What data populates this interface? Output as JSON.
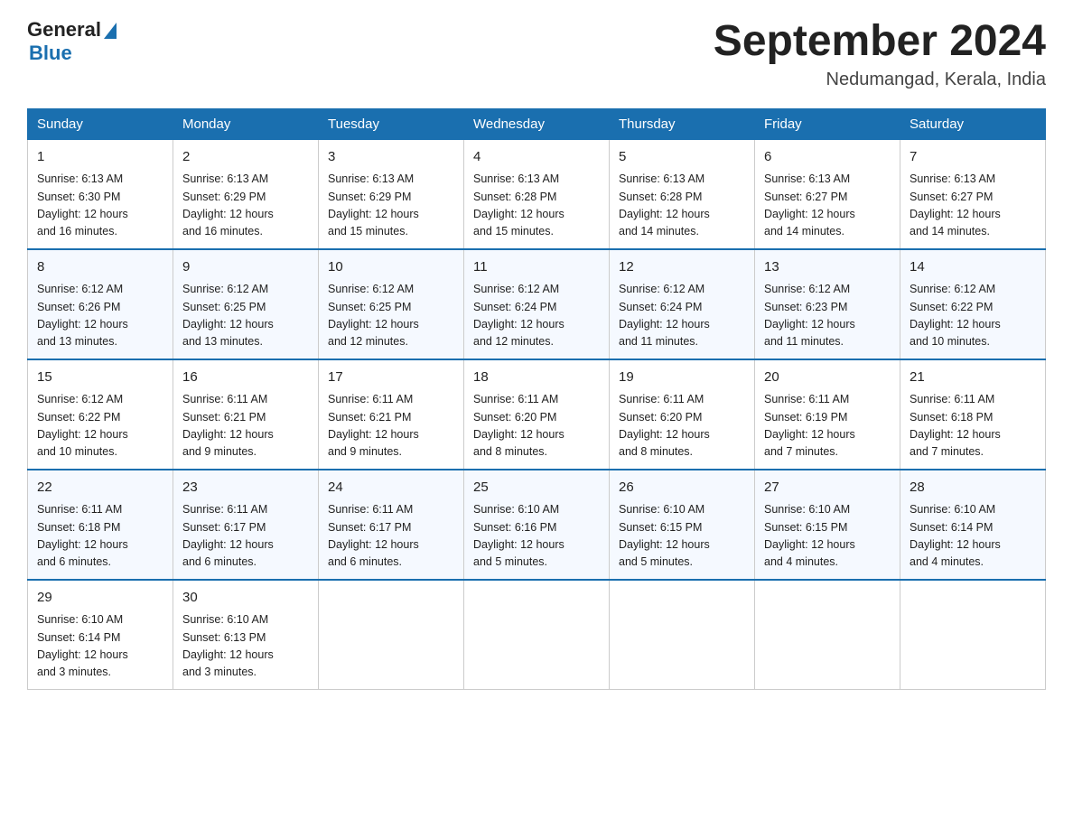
{
  "header": {
    "logo_general": "General",
    "logo_blue": "Blue",
    "title": "September 2024",
    "subtitle": "Nedumangad, Kerala, India"
  },
  "days_of_week": [
    "Sunday",
    "Monday",
    "Tuesday",
    "Wednesday",
    "Thursday",
    "Friday",
    "Saturday"
  ],
  "weeks": [
    [
      {
        "day": "1",
        "sunrise": "6:13 AM",
        "sunset": "6:30 PM",
        "daylight": "12 hours and 16 minutes."
      },
      {
        "day": "2",
        "sunrise": "6:13 AM",
        "sunset": "6:29 PM",
        "daylight": "12 hours and 16 minutes."
      },
      {
        "day": "3",
        "sunrise": "6:13 AM",
        "sunset": "6:29 PM",
        "daylight": "12 hours and 15 minutes."
      },
      {
        "day": "4",
        "sunrise": "6:13 AM",
        "sunset": "6:28 PM",
        "daylight": "12 hours and 15 minutes."
      },
      {
        "day": "5",
        "sunrise": "6:13 AM",
        "sunset": "6:28 PM",
        "daylight": "12 hours and 14 minutes."
      },
      {
        "day": "6",
        "sunrise": "6:13 AM",
        "sunset": "6:27 PM",
        "daylight": "12 hours and 14 minutes."
      },
      {
        "day": "7",
        "sunrise": "6:13 AM",
        "sunset": "6:27 PM",
        "daylight": "12 hours and 14 minutes."
      }
    ],
    [
      {
        "day": "8",
        "sunrise": "6:12 AM",
        "sunset": "6:26 PM",
        "daylight": "12 hours and 13 minutes."
      },
      {
        "day": "9",
        "sunrise": "6:12 AM",
        "sunset": "6:25 PM",
        "daylight": "12 hours and 13 minutes."
      },
      {
        "day": "10",
        "sunrise": "6:12 AM",
        "sunset": "6:25 PM",
        "daylight": "12 hours and 12 minutes."
      },
      {
        "day": "11",
        "sunrise": "6:12 AM",
        "sunset": "6:24 PM",
        "daylight": "12 hours and 12 minutes."
      },
      {
        "day": "12",
        "sunrise": "6:12 AM",
        "sunset": "6:24 PM",
        "daylight": "12 hours and 11 minutes."
      },
      {
        "day": "13",
        "sunrise": "6:12 AM",
        "sunset": "6:23 PM",
        "daylight": "12 hours and 11 minutes."
      },
      {
        "day": "14",
        "sunrise": "6:12 AM",
        "sunset": "6:22 PM",
        "daylight": "12 hours and 10 minutes."
      }
    ],
    [
      {
        "day": "15",
        "sunrise": "6:12 AM",
        "sunset": "6:22 PM",
        "daylight": "12 hours and 10 minutes."
      },
      {
        "day": "16",
        "sunrise": "6:11 AM",
        "sunset": "6:21 PM",
        "daylight": "12 hours and 9 minutes."
      },
      {
        "day": "17",
        "sunrise": "6:11 AM",
        "sunset": "6:21 PM",
        "daylight": "12 hours and 9 minutes."
      },
      {
        "day": "18",
        "sunrise": "6:11 AM",
        "sunset": "6:20 PM",
        "daylight": "12 hours and 8 minutes."
      },
      {
        "day": "19",
        "sunrise": "6:11 AM",
        "sunset": "6:20 PM",
        "daylight": "12 hours and 8 minutes."
      },
      {
        "day": "20",
        "sunrise": "6:11 AM",
        "sunset": "6:19 PM",
        "daylight": "12 hours and 7 minutes."
      },
      {
        "day": "21",
        "sunrise": "6:11 AM",
        "sunset": "6:18 PM",
        "daylight": "12 hours and 7 minutes."
      }
    ],
    [
      {
        "day": "22",
        "sunrise": "6:11 AM",
        "sunset": "6:18 PM",
        "daylight": "12 hours and 6 minutes."
      },
      {
        "day": "23",
        "sunrise": "6:11 AM",
        "sunset": "6:17 PM",
        "daylight": "12 hours and 6 minutes."
      },
      {
        "day": "24",
        "sunrise": "6:11 AM",
        "sunset": "6:17 PM",
        "daylight": "12 hours and 6 minutes."
      },
      {
        "day": "25",
        "sunrise": "6:10 AM",
        "sunset": "6:16 PM",
        "daylight": "12 hours and 5 minutes."
      },
      {
        "day": "26",
        "sunrise": "6:10 AM",
        "sunset": "6:15 PM",
        "daylight": "12 hours and 5 minutes."
      },
      {
        "day": "27",
        "sunrise": "6:10 AM",
        "sunset": "6:15 PM",
        "daylight": "12 hours and 4 minutes."
      },
      {
        "day": "28",
        "sunrise": "6:10 AM",
        "sunset": "6:14 PM",
        "daylight": "12 hours and 4 minutes."
      }
    ],
    [
      {
        "day": "29",
        "sunrise": "6:10 AM",
        "sunset": "6:14 PM",
        "daylight": "12 hours and 3 minutes."
      },
      {
        "day": "30",
        "sunrise": "6:10 AM",
        "sunset": "6:13 PM",
        "daylight": "12 hours and 3 minutes."
      },
      null,
      null,
      null,
      null,
      null
    ]
  ],
  "labels": {
    "sunrise": "Sunrise:",
    "sunset": "Sunset:",
    "daylight": "Daylight:"
  }
}
